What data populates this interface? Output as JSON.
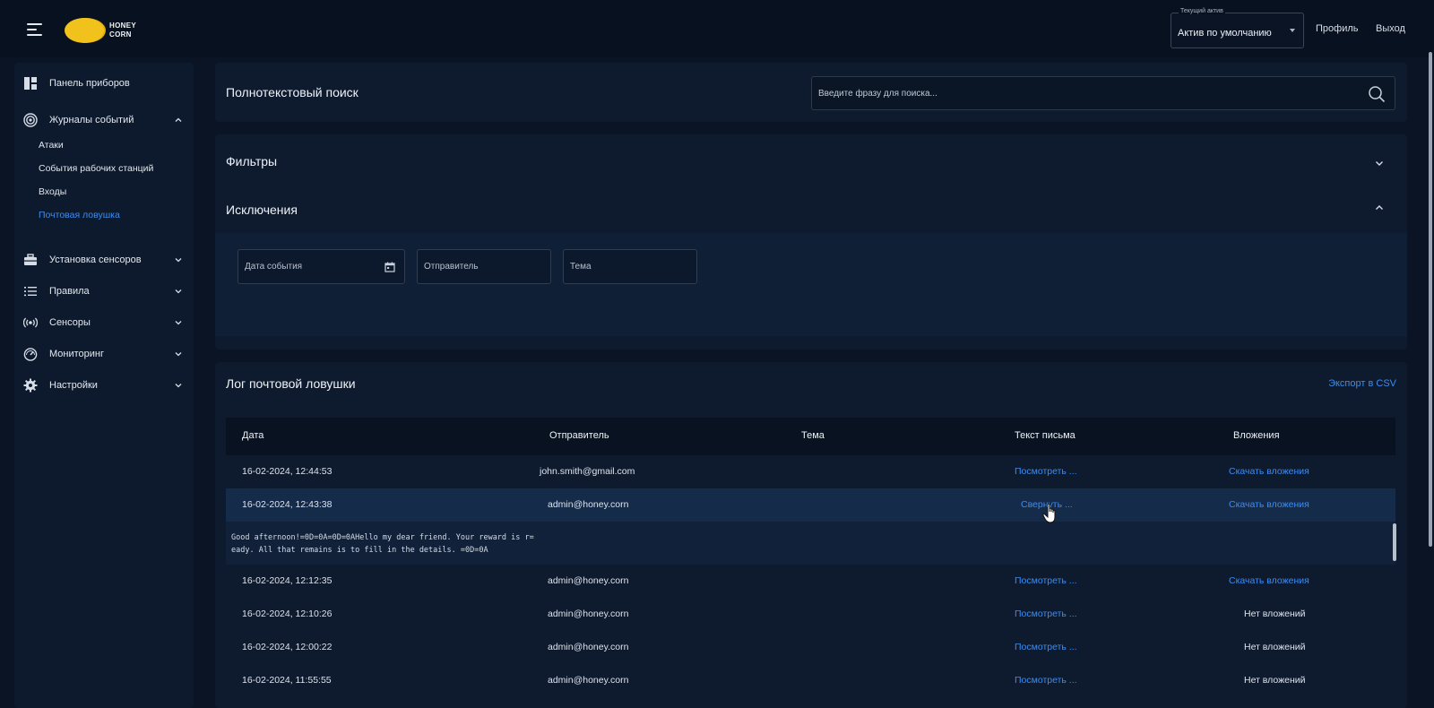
{
  "app": {
    "logo_text_line1": "HONEY",
    "logo_text_line2": "CORN"
  },
  "header": {
    "asset_label": "Текущий актив",
    "asset_value": "Актив по умолчанию",
    "profile_label": "Профиль",
    "logout_label": "Выход"
  },
  "sidebar": {
    "items": [
      {
        "label": "Панель приборов",
        "icon": "dashboard-icon"
      },
      {
        "label": "Журналы событий",
        "icon": "target-icon"
      },
      {
        "label": "Установка сенсоров",
        "icon": "toolbox-icon"
      },
      {
        "label": "Правила",
        "icon": "list-icon"
      },
      {
        "label": "Сенсоры",
        "icon": "broadcast-icon"
      },
      {
        "label": "Мониторинг",
        "icon": "gauge-icon"
      },
      {
        "label": "Настройки",
        "icon": "gear-icon"
      }
    ],
    "sub_items": [
      {
        "label": "Атаки",
        "active": false
      },
      {
        "label": "События рабочих станций",
        "active": false
      },
      {
        "label": "Входы",
        "active": false
      },
      {
        "label": "Почтовая ловушка",
        "active": true
      }
    ]
  },
  "search": {
    "title": "Полнотекстовый поиск",
    "placeholder": "Введите фразу для поиска..."
  },
  "filters": {
    "title": "Фильтры",
    "exclusions_title": "Исключения",
    "fields": [
      {
        "placeholder": "Дата события"
      },
      {
        "placeholder": "Отправитель"
      },
      {
        "placeholder": "Тема"
      }
    ]
  },
  "log": {
    "title": "Лог почтовой ловушки",
    "export_label": "Экспорт в CSV",
    "columns": [
      "Дата",
      "Отправитель",
      "Тема",
      "Текст письма",
      "Вложения"
    ],
    "rows": [
      {
        "date": "16-02-2024, 12:44:53",
        "sender": "john.smith@gmail.com",
        "subject": "",
        "text_action": "Посмотреть ...",
        "attachments": "Скачать вложения",
        "attachments_link": true
      },
      {
        "date": "16-02-2024, 12:43:38",
        "sender": "admin@honey.corn",
        "subject": "",
        "text_action": "Свернуть ...",
        "attachments": "Скачать вложения",
        "attachments_link": true
      },
      {
        "date": "16-02-2024, 12:12:35",
        "sender": "admin@honey.corn",
        "subject": "",
        "text_action": "Посмотреть ...",
        "attachments": "Скачать вложения",
        "attachments_link": true
      },
      {
        "date": "16-02-2024, 12:10:26",
        "sender": "admin@honey.corn",
        "subject": "",
        "text_action": "Посмотреть ...",
        "attachments": "Нет вложений",
        "attachments_link": false
      },
      {
        "date": "16-02-2024, 12:00:22",
        "sender": "admin@honey.corn",
        "subject": "",
        "text_action": "Посмотреть ...",
        "attachments": "Нет вложений",
        "attachments_link": false
      },
      {
        "date": "16-02-2024, 11:55:55",
        "sender": "admin@honey.corn",
        "subject": "",
        "text_action": "Посмотреть ...",
        "attachments": "Нет вложений",
        "attachments_link": false
      }
    ],
    "expanded_text": "Good afternoon!=0D=0A=0D=0AHello my dear friend. Your reward is r=\neady. All that remains is to fill in the details. =0D=0A"
  },
  "colors": {
    "background": "#0a1424",
    "panel": "#0e1b2f",
    "accent": "#3c8cf0",
    "logo": "#f2c21c"
  }
}
